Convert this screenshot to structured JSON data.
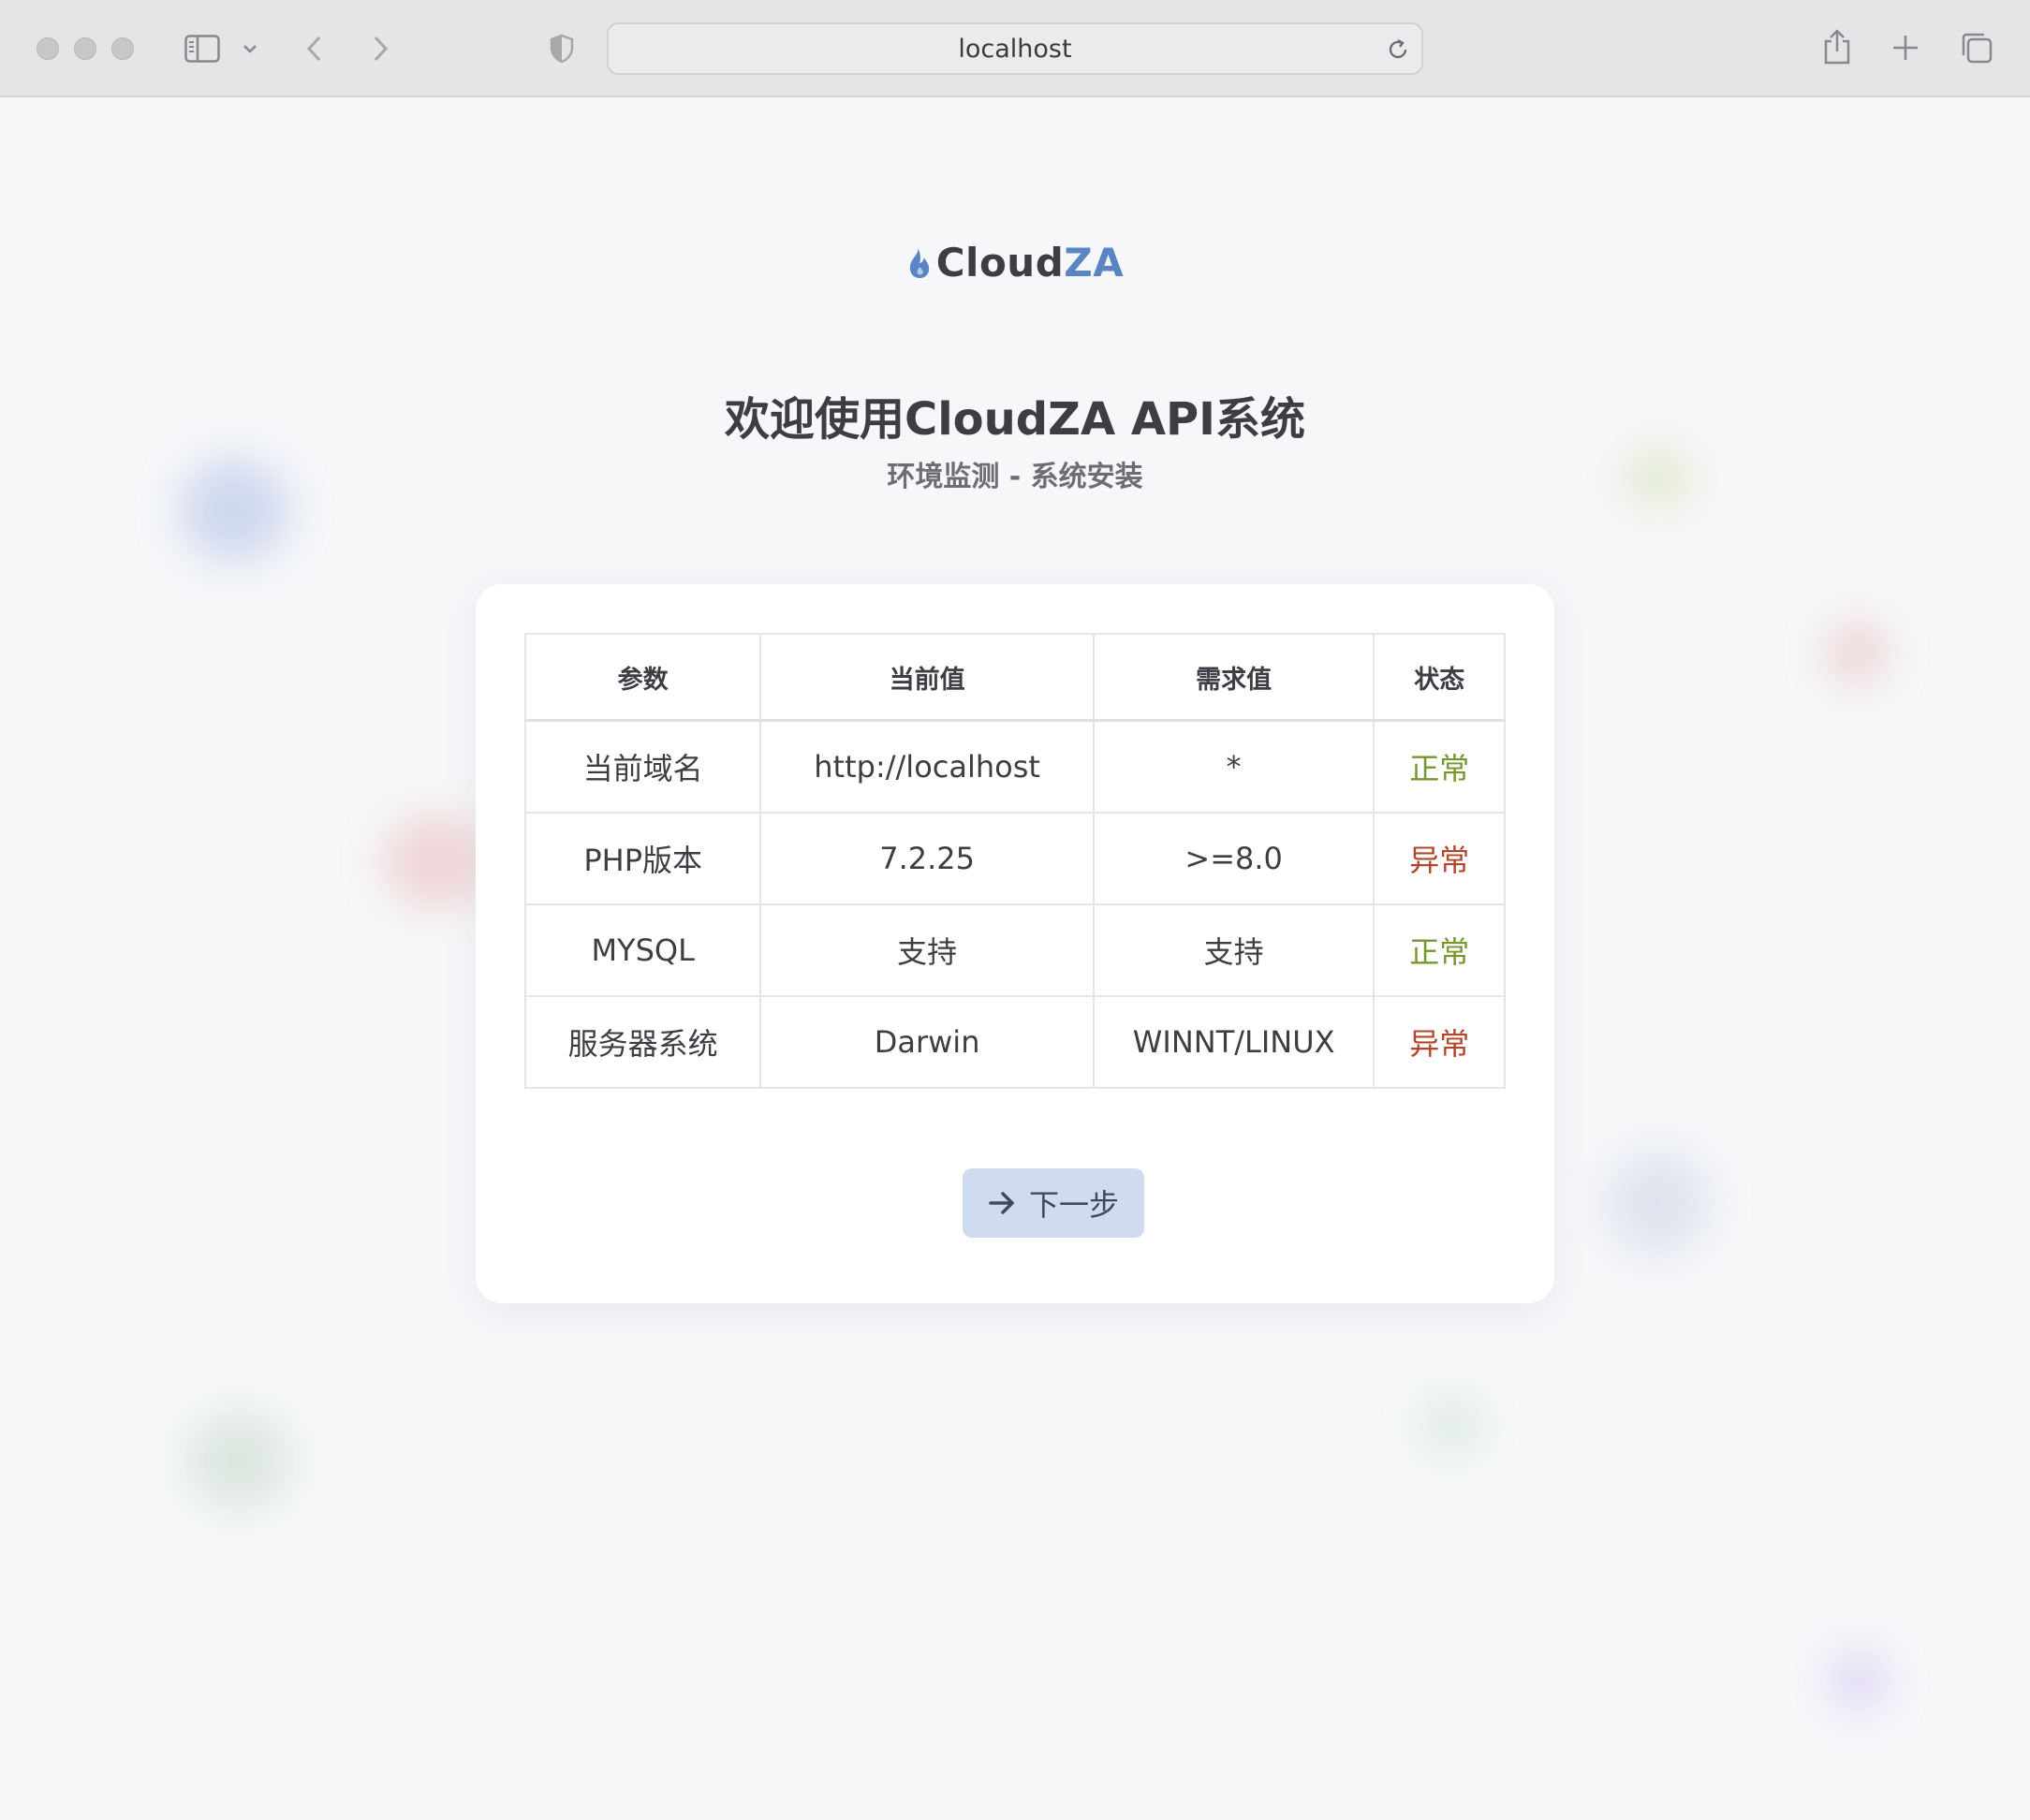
{
  "browser": {
    "url": "localhost"
  },
  "logo": {
    "name_part1": "Cloud",
    "name_part2": "ZA",
    "icon": "flame-icon"
  },
  "header": {
    "title": "欢迎使用CloudZA API系统",
    "subtitle": "环境监测 - 系统安装"
  },
  "table": {
    "columns": [
      "参数",
      "当前值",
      "需求值",
      "状态"
    ],
    "rows": [
      {
        "param": "当前域名",
        "current": "http://localhost",
        "required": "*",
        "status": "正常",
        "status_type": "ok"
      },
      {
        "param": "PHP版本",
        "current": "7.2.25",
        "required": ">=8.0",
        "status": "异常",
        "status_type": "bad"
      },
      {
        "param": "MYSQL",
        "current": "支持",
        "required": "支持",
        "status": "正常",
        "status_type": "ok"
      },
      {
        "param": "服务器系统",
        "current": "Darwin",
        "required": "WINNT/LINUX",
        "status": "异常",
        "status_type": "bad"
      }
    ]
  },
  "actions": {
    "next_label": "下一步",
    "next_icon": "arrow-right-icon"
  },
  "colors": {
    "accent": "#5b84c4",
    "ok": "#76962e",
    "bad": "#b3452c",
    "button_bg": "#cfdcf0"
  }
}
